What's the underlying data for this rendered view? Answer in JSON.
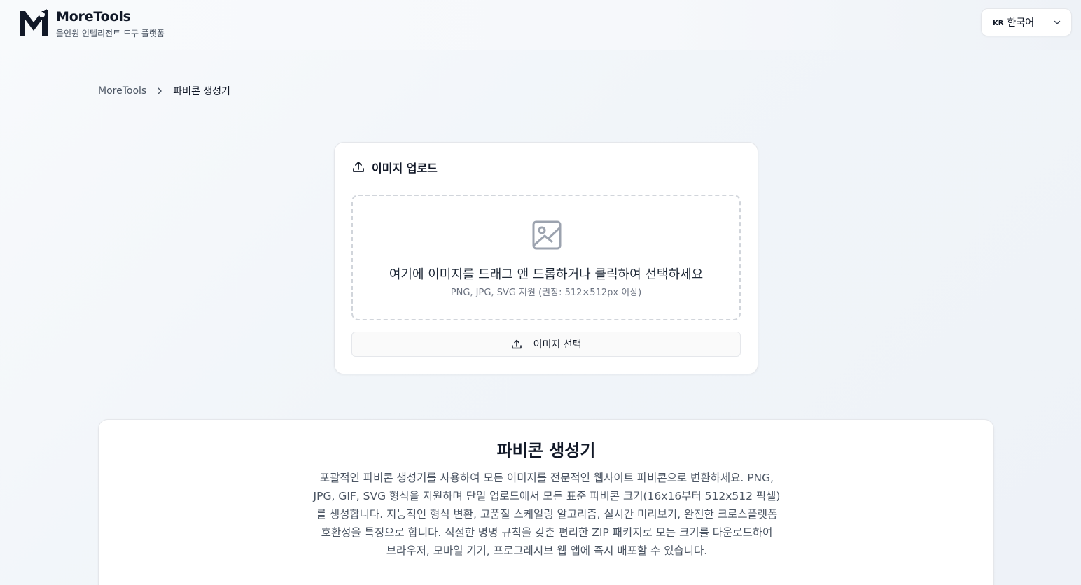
{
  "header": {
    "brand_name": "MoreTools",
    "brand_tagline": "올인원 인텔리전트 도구 플랫폼",
    "language": {
      "code": "KR",
      "label": "한국어"
    }
  },
  "breadcrumb": {
    "home": "MoreTools",
    "current": "파비콘 생성기"
  },
  "upload_card": {
    "title": "이미지 업로드",
    "dropzone_main": "여기에 이미지를 드래그 앤 드롭하거나 클릭하여 선택하세요",
    "dropzone_sub": "PNG, JPG, SVG 지원 (권장: 512×512px 이상)",
    "select_button": "이미지 선택"
  },
  "info_card": {
    "title": "파비콘 생성기",
    "description": "포괄적인 파비콘 생성기를 사용하여 모든 이미지를 전문적인 웹사이트 파비콘으로 변환하세요. PNG, JPG, GIF, SVG 형식을 지원하며 단일 업로드에서 모든 표준 파비콘 크기(16x16부터 512x512 픽셀)를 생성합니다. 지능적인 형식 변환, 고품질 스케일링 알고리즘, 실시간 미리보기, 완전한 크로스플랫폼 호환성을 특징으로 합니다. 적절한 명명 규칙을 갖춘 편리한 ZIP 패키지로 모든 크기를 다운로드하여 브라우저, 모바일 기기, 프로그레시브 웹 앱에 즉시 배포할 수 있습니다."
  },
  "icons": {
    "logo": "moretools-logo",
    "language_chevron": "chevron-down-icon",
    "breadcrumb_separator": "chevron-right-icon",
    "card_header": "upload-icon",
    "dropzone": "image-icon",
    "select_button": "upload-icon"
  },
  "colors": {
    "text_primary": "#111827",
    "text_muted": "#6b7280",
    "border": "#e5e7eb",
    "dropzone_border": "#d1d5db",
    "icon_gray": "#9ca3af"
  }
}
